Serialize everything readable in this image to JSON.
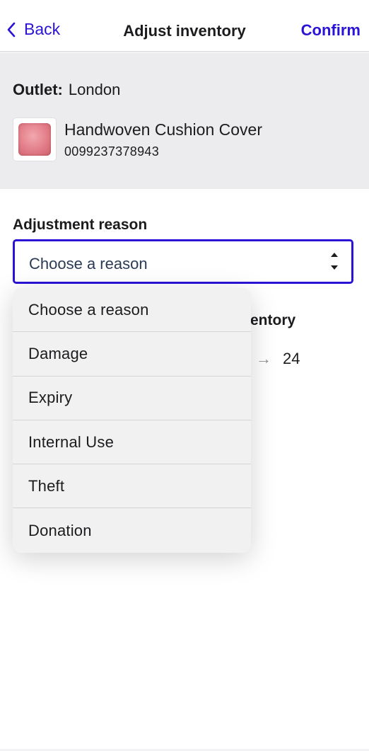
{
  "nav": {
    "back_label": "Back",
    "title": "Adjust inventory",
    "confirm_label": "Confirm",
    "accent_color": "#2a13d6"
  },
  "outlet": {
    "label": "Outlet:",
    "value": "London"
  },
  "product": {
    "name": "Handwoven Cushion Cover",
    "sku": "0099237378943",
    "image_icon": "pink-cushion-image"
  },
  "adjustment": {
    "label": "Adjustment reason",
    "selected": "Choose a reason"
  },
  "inventory": {
    "label_visible": "entory",
    "new_value": "24"
  },
  "dropdown": {
    "options": [
      "Choose a reason",
      "Damage",
      "Expiry",
      "Internal Use",
      "Theft",
      "Donation"
    ]
  }
}
